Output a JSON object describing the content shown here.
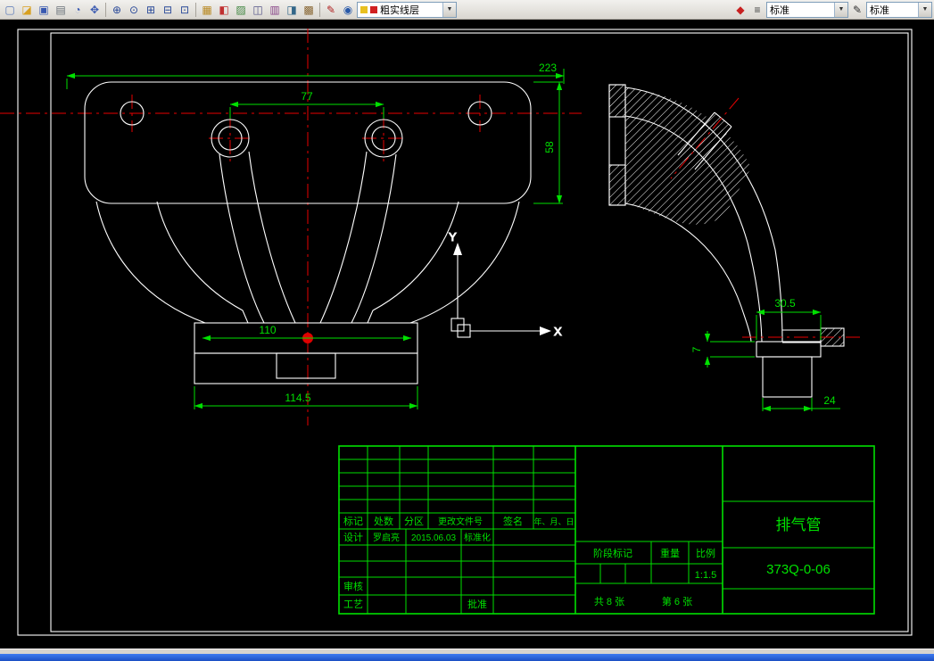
{
  "toolbar": {
    "file_icons": [
      {
        "name": "new-icon",
        "glyph": "▢"
      },
      {
        "name": "open-icon",
        "glyph": "◪"
      },
      {
        "name": "save-icon",
        "glyph": "▣"
      },
      {
        "name": "print-icon",
        "glyph": "▤"
      },
      {
        "name": "preview-icon",
        "glyph": "◔"
      },
      {
        "name": "pan-icon",
        "glyph": "✥"
      }
    ],
    "zoom_icons": [
      {
        "name": "zoom-window-icon",
        "glyph": "⊕"
      },
      {
        "name": "zoom-dynamic-icon",
        "glyph": "⊙"
      },
      {
        "name": "zoom-in-icon",
        "glyph": "⊞"
      },
      {
        "name": "zoom-out-icon",
        "glyph": "⊟"
      },
      {
        "name": "zoom-extents-icon",
        "glyph": "⊡"
      }
    ],
    "draw_icons": [
      {
        "name": "layers-icon",
        "glyph": "▦"
      },
      {
        "name": "layer-color-icon",
        "glyph": "◧"
      },
      {
        "name": "linetype-icon",
        "glyph": "▨"
      },
      {
        "name": "text-style-icon",
        "glyph": "◫"
      },
      {
        "name": "dim-style-icon",
        "glyph": "▥"
      },
      {
        "name": "table-icon",
        "glyph": "◨"
      },
      {
        "name": "properties-icon",
        "glyph": "▩"
      }
    ],
    "mid_icons": [
      {
        "name": "match-props-icon",
        "glyph": "✎"
      },
      {
        "name": "regen-icon",
        "glyph": "◉"
      }
    ],
    "right_icons": [
      {
        "name": "color-control-icon",
        "glyph": "◆"
      },
      {
        "name": "lineweight-icon",
        "glyph": "≡"
      }
    ],
    "far_right_icons": [
      {
        "name": "style-edit-icon",
        "glyph": "✎"
      }
    ],
    "layer_combo_value": "粗实线层",
    "style_combo1_value": "标准",
    "style_combo2_value": "标准"
  },
  "colors": {
    "geometry": "#ffffff",
    "centerline": "#e80000",
    "dimension": "#00e000",
    "canvas_bg": "#000000"
  },
  "drawing": {
    "axis": {
      "x_label": "X",
      "y_label": "Y"
    },
    "dimensions": {
      "flange_width": "223",
      "port_spacing": "77",
      "flange_height": "58",
      "outlet_width": "110",
      "outlet_plate_width": "114.5",
      "side_flange_width": "30.5",
      "side_flange_thickness": "7",
      "side_block_width": "24"
    }
  },
  "title_block": {
    "header": {
      "mark": "标记",
      "count": "处数",
      "zone": "分区",
      "change_no": "更改文件号",
      "sign": "签名",
      "date": "年、月、日"
    },
    "design_label": "设计",
    "designer": "罗启亮",
    "design_date": "2015.06.03",
    "standardization_label": "标准化",
    "check_label": "审核",
    "process_label": "工艺",
    "approve_label": "批准",
    "stage_mark_label": "阶段标记",
    "weight_label": "重量",
    "scale_label": "比例",
    "scale_value": "1:1.5",
    "part_name": "排气管",
    "drawing_no": "373Q-0-06",
    "sheets_total": "共 8 张",
    "sheet_current": "第 6 张"
  }
}
